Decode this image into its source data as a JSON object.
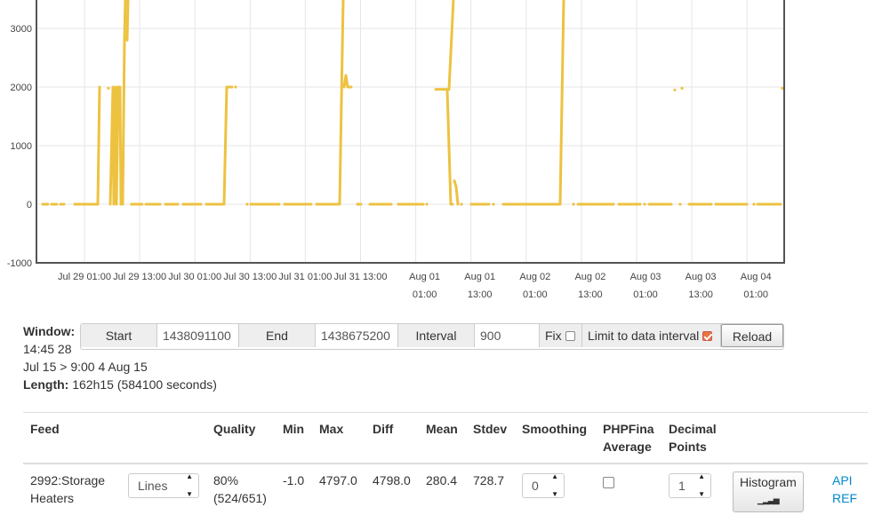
{
  "chart_data": {
    "type": "line",
    "color": "#edc240",
    "ylim": [
      -1000,
      3500
    ],
    "y_ticks": [
      "3000",
      "2000",
      "1000",
      "0",
      "-1000"
    ],
    "x_ticks": [
      [
        "Jul 29 01:00"
      ],
      [
        "Jul 29 13:00"
      ],
      [
        "Jul 30 01:00"
      ],
      [
        "Jul 30 13:00"
      ],
      [
        "Jul 31 01:00"
      ],
      [
        "Jul 31 13:00"
      ],
      [
        "Aug 01",
        "01:00"
      ],
      [
        "Aug 01",
        "13:00"
      ],
      [
        "Aug 02",
        "01:00"
      ],
      [
        "Aug 02",
        "13:00"
      ],
      [
        "Aug 03",
        "01:00"
      ],
      [
        "Aug 03",
        "13:00"
      ],
      [
        "Aug 04",
        "01:00"
      ]
    ],
    "segments": [
      [
        [
          48,
          0
        ],
        [
          54,
          0
        ]
      ],
      [
        [
          58,
          0
        ],
        [
          64,
          0
        ]
      ],
      [
        [
          68,
          0
        ],
        [
          72,
          0
        ]
      ],
      [
        [
          84,
          0
        ],
        [
          110,
          0
        ],
        [
          112,
          2000
        ]
      ],
      [
        [
          124,
          0
        ],
        [
          127,
          2000
        ],
        [
          128,
          0
        ],
        [
          130,
          2000
        ],
        [
          131,
          0
        ],
        [
          133,
          2000
        ],
        [
          135,
          2000
        ],
        [
          136,
          0
        ],
        [
          138,
          0
        ],
        [
          140,
          2800
        ],
        [
          141,
          3500
        ]
      ],
      [
        [
          143,
          2800
        ],
        [
          144,
          3500
        ]
      ],
      [
        [
          150,
          0
        ],
        [
          160,
          0
        ]
      ],
      [
        [
          164,
          0
        ],
        [
          180,
          0
        ]
      ],
      [
        [
          186,
          0
        ],
        [
          200,
          0
        ]
      ],
      [
        [
          206,
          0
        ],
        [
          226,
          0
        ]
      ],
      [
        [
          232,
          0
        ],
        [
          252,
          0
        ],
        [
          255,
          2000
        ],
        [
          261,
          2000
        ]
      ],
      [
        [
          282,
          0
        ],
        [
          314,
          0
        ]
      ],
      [
        [
          320,
          0
        ],
        [
          350,
          0
        ]
      ],
      [
        [
          356,
          0
        ],
        [
          382,
          0
        ],
        [
          386,
          3500
        ]
      ],
      [
        [
          387,
          2000
        ],
        [
          389,
          2200
        ],
        [
          391,
          2000
        ],
        [
          395,
          2000
        ]
      ],
      [
        [
          402,
          0
        ],
        [
          406,
          0
        ]
      ],
      [
        [
          416,
          0
        ],
        [
          440,
          0
        ]
      ],
      [
        [
          450,
          0
        ],
        [
          476,
          0
        ]
      ],
      [
        [
          490,
          1960
        ],
        [
          503,
          1960
        ],
        [
          507,
          0
        ],
        [
          509,
          0
        ]
      ],
      [
        [
          505,
          1960
        ],
        [
          510,
          3500
        ]
      ],
      [
        [
          511,
          400
        ],
        [
          513,
          300
        ],
        [
          515,
          0
        ]
      ],
      [
        [
          530,
          0
        ],
        [
          550,
          0
        ]
      ],
      [
        [
          566,
          0
        ],
        [
          630,
          0
        ],
        [
          634,
          3500
        ]
      ],
      [
        [
          650,
          0
        ],
        [
          690,
          0
        ]
      ],
      [
        [
          696,
          0
        ],
        [
          720,
          0
        ]
      ],
      [
        [
          730,
          0
        ],
        [
          755,
          0
        ]
      ],
      [
        [
          775,
          0
        ],
        [
          800,
          0
        ]
      ],
      [
        [
          805,
          0
        ],
        [
          840,
          0
        ]
      ],
      [
        [
          852,
          0
        ],
        [
          878,
          0
        ]
      ]
    ],
    "dots": [
      [
        122,
        1980
      ],
      [
        148,
        0
      ],
      [
        265,
        2000
      ],
      [
        759,
        1950
      ],
      [
        767,
        1980
      ],
      [
        880,
        1980
      ],
      [
        100,
        0
      ],
      [
        278,
        0
      ],
      [
        403,
        0
      ],
      [
        448,
        0
      ],
      [
        480,
        0
      ],
      [
        519,
        0
      ],
      [
        555,
        0
      ],
      [
        645,
        0
      ],
      [
        725,
        0
      ],
      [
        765,
        0
      ],
      [
        848,
        0
      ]
    ]
  },
  "window": {
    "label": "Window:",
    "line2": "14:45 28",
    "line3": "Jul 15 > 9:00 4 Aug 15",
    "length_label": "Length:",
    "length_value": "162h15 (584100 seconds)"
  },
  "controls": {
    "start_label": "Start",
    "start_value": "1438091100",
    "end_label": "End",
    "end_value": "1438675200",
    "interval_label": "Interval",
    "interval_value": "900",
    "fix_label": "Fix",
    "limit_label": "Limit to data interval",
    "reload_label": "Reload"
  },
  "table": {
    "headers": {
      "feed": "Feed",
      "quality": "Quality",
      "min": "Min",
      "max": "Max",
      "diff": "Diff",
      "mean": "Mean",
      "stdev": "Stdev",
      "smoothing": "Smoothing",
      "phpfina_1": "PHPFina",
      "phpfina_2": "Average",
      "decimal_1": "Decimal",
      "decimal_2": "Points"
    },
    "row": {
      "feed_1": "2992:Storage",
      "feed_2": "Heaters",
      "plot_type": "Lines",
      "quality_1": "80%",
      "quality_2": "(524/651)",
      "min": "-1.0",
      "max": "4797.0",
      "diff": "4798.0",
      "mean": "280.4",
      "stdev": "728.7",
      "smoothing": "0",
      "decimals": "1",
      "histogram_label": "Histogram",
      "api_label": "API",
      "ref_label": "REF"
    }
  }
}
